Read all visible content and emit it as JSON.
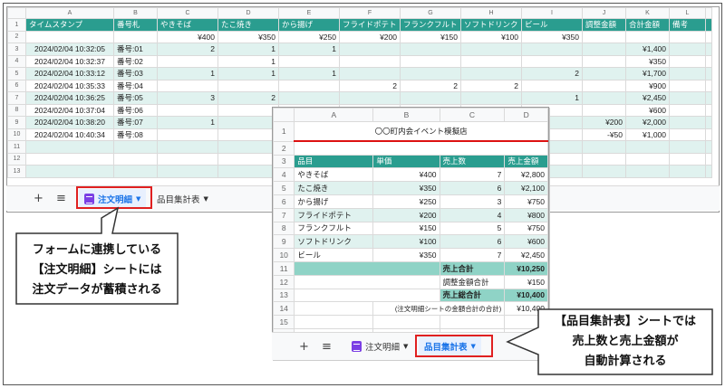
{
  "sheet1": {
    "col_letters": [
      "A",
      "B",
      "C",
      "D",
      "E",
      "F",
      "G",
      "H",
      "I",
      "J",
      "K",
      "L"
    ],
    "header": [
      "タイムスタンプ",
      "番号札",
      "やきそば",
      "たこ焼き",
      "から揚げ",
      "フライドポテト",
      "フランクフルト",
      "ソフトドリンク",
      "ビール",
      "調整金額",
      "合計金額",
      "備考"
    ],
    "prices": [
      "",
      "",
      "¥400",
      "¥350",
      "¥250",
      "¥200",
      "¥150",
      "¥100",
      "¥350",
      "",
      "",
      ""
    ],
    "rows": [
      [
        "2024/02/04 10:32:05",
        "番号:01",
        "2",
        "1",
        "1",
        "",
        "",
        "",
        "",
        "",
        "¥1,400",
        ""
      ],
      [
        "2024/02/04 10:32:37",
        "番号:02",
        "",
        "1",
        "",
        "",
        "",
        "",
        "",
        "",
        "¥350",
        ""
      ],
      [
        "2024/02/04 10:33:12",
        "番号:03",
        "1",
        "1",
        "1",
        "",
        "",
        "",
        "2",
        "",
        "¥1,700",
        ""
      ],
      [
        "2024/02/04 10:35:33",
        "番号:04",
        "",
        "",
        "",
        "2",
        "2",
        "2",
        "",
        "",
        "¥900",
        ""
      ],
      [
        "2024/02/04 10:36:25",
        "番号:05",
        "3",
        "2",
        "",
        "",
        "",
        "",
        "1",
        "",
        "¥2,450",
        ""
      ],
      [
        "2024/02/04 10:37:04",
        "番号:06",
        "",
        "",
        "",
        "",
        "",
        "",
        "",
        "",
        "¥600",
        ""
      ],
      [
        "2024/02/04 10:38:20",
        "番号:07",
        "1",
        "",
        "",
        "",
        "",
        "",
        "",
        "¥200",
        "¥2,000",
        ""
      ],
      [
        "2024/02/04 10:40:34",
        "番号:08",
        "",
        "",
        "",
        "",
        "",
        "",
        "",
        "-¥50",
        "¥1,000",
        ""
      ],
      [
        "",
        "",
        "",
        "",
        "",
        "",
        "",
        "",
        "",
        "",
        "",
        ""
      ],
      [
        "",
        "",
        "",
        "",
        "",
        "",
        "",
        "",
        "",
        "",
        "",
        ""
      ],
      [
        "",
        "",
        "",
        "",
        "",
        "",
        "",
        "",
        "",
        "",
        "",
        ""
      ]
    ],
    "tabs": {
      "plus": "+",
      "menu": "≡",
      "tab1": "注文明細",
      "tab2": "品目集計表"
    }
  },
  "sheet2": {
    "col_letters": [
      "A",
      "B",
      "C",
      "D"
    ],
    "title": "〇〇町内会イベント模擬店",
    "header": [
      "品目",
      "単価",
      "売上数",
      "売上金額"
    ],
    "items": [
      [
        "やきそば",
        "¥400",
        "7",
        "¥2,800"
      ],
      [
        "たこ焼き",
        "¥350",
        "6",
        "¥2,100"
      ],
      [
        "から揚げ",
        "¥250",
        "3",
        "¥750"
      ],
      [
        "フライドポテト",
        "¥200",
        "4",
        "¥800"
      ],
      [
        "フランクフルト",
        "¥150",
        "5",
        "¥750"
      ],
      [
        "ソフトドリンク",
        "¥100",
        "6",
        "¥600"
      ],
      [
        "ビール",
        "¥350",
        "7",
        "¥2,450"
      ]
    ],
    "sales_total_label": "売上合計",
    "sales_total": "¥10,250",
    "adjust_label": "調整金額合計",
    "adjust_total": "¥150",
    "grand_total_label": "売上総合計",
    "grand_total": "¥10,400",
    "check_label": "(注文明細シートの金額合計の合計)",
    "check_total": "¥10,400",
    "tabs": {
      "plus": "+",
      "menu": "≡",
      "tab1": "注文明細",
      "tab2": "品目集計表"
    }
  },
  "callouts": {
    "left": [
      "フォームに連携している",
      "【注文明細】シートには",
      "注文データが蓄積される"
    ],
    "right": [
      "【品目集計表】シートでは",
      "売上数と売上金額が",
      "自動計算される"
    ]
  },
  "colors": {
    "teal": "#2a9d8f",
    "light_teal": "#e0f2ef",
    "sum_teal": "#8fd3c6",
    "red": "#e02020",
    "active_tab": "#1a73e8"
  }
}
